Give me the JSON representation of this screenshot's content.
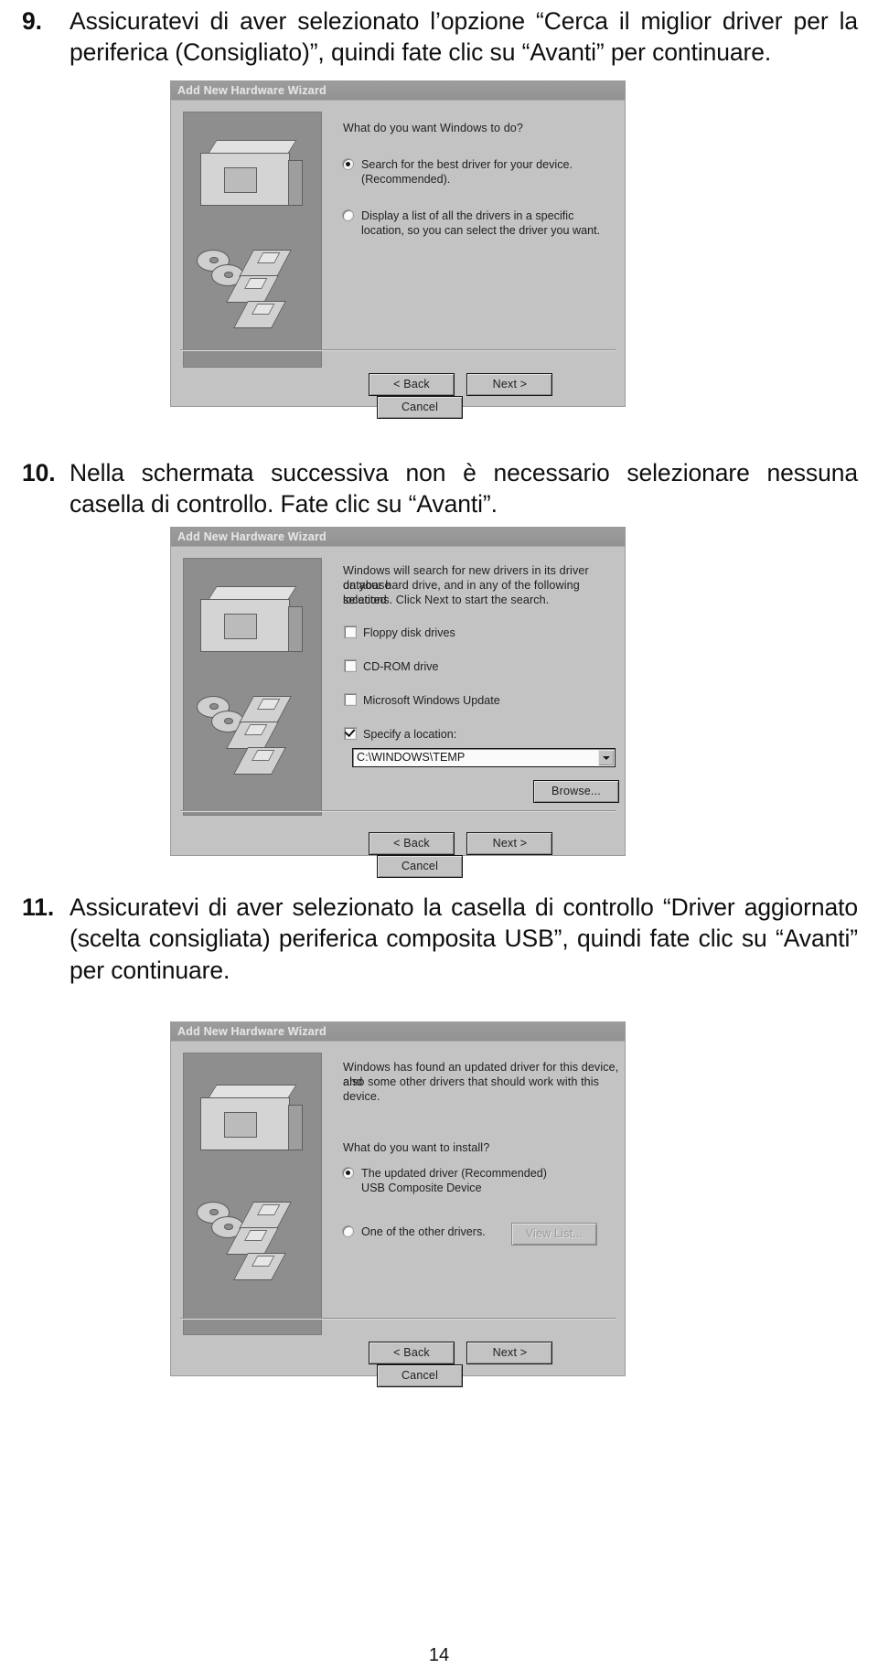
{
  "page": {
    "number": "14",
    "language": "it"
  },
  "instructions": [
    {
      "number": "9.",
      "text": "Assicuratevi di aver selezionato l’opzione “Cerca il miglior driver per la periferica (Consigliato)”, quindi fate clic su “Avanti” per continuare."
    },
    {
      "number": "10.",
      "text": "Nella schermata successiva non è necessario selezionare nessuna casella di controllo. Fate clic su “Avanti”."
    },
    {
      "number": "11.",
      "text": "Assicuratevi di aver selezionato la casella di controllo “Driver aggiornato (scelta consigliata) periferica composita USB”, quindi fate clic su “Avanti” per continuare."
    }
  ],
  "dialogs": [
    {
      "id": "wizard-step-1",
      "title": "Add New Hardware Wizard",
      "prompt": "What do you want Windows to do?",
      "options": [
        {
          "label_line1": "Search for the best driver for your device.",
          "label_line2": "(Recommended).",
          "selected": true
        },
        {
          "label_line1": "Display a list of all the drivers in a specific",
          "label_line2": "location, so you can select the driver you want.",
          "selected": false
        }
      ],
      "buttons": [
        {
          "label": "< Back",
          "disabled": false
        },
        {
          "label": "Next >",
          "disabled": false
        },
        {
          "label": "Cancel",
          "disabled": false
        }
      ]
    },
    {
      "id": "wizard-step-2",
      "title": "Add New Hardware Wizard",
      "body_line1": "Windows will search for new drivers in its driver database",
      "body_line2": "on your hard drive, and in any of the following selected",
      "body_line3": "locations. Click Next to start the search.",
      "checkboxes": [
        {
          "label": "Floppy disk drives",
          "checked": false
        },
        {
          "label": "CD-ROM drive",
          "checked": false
        },
        {
          "label": "Microsoft Windows Update",
          "checked": false
        },
        {
          "label": "Specify a location:",
          "checked": true
        }
      ],
      "location_value": "C:\\WINDOWS\\TEMP",
      "browse_button": "Browse...",
      "buttons": [
        {
          "label": "< Back",
          "disabled": false
        },
        {
          "label": "Next >",
          "disabled": false
        },
        {
          "label": "Cancel",
          "disabled": false
        }
      ]
    },
    {
      "id": "wizard-step-3",
      "title": "Add New Hardware Wizard",
      "body_line1": "Windows has found an updated driver for this device, and",
      "body_line2": "also some other drivers that should work with this device.",
      "prompt": "What do you want to install?",
      "options": [
        {
          "label_line1": "The updated driver (Recommended)",
          "label_line2": "USB Composite Device",
          "selected": true
        },
        {
          "label_line1": "One of the other drivers.",
          "label_line2": "",
          "selected": false
        }
      ],
      "view_list_button": "View List...",
      "buttons": [
        {
          "label": "< Back",
          "disabled": false
        },
        {
          "label": "Next >",
          "disabled": false
        },
        {
          "label": "Cancel",
          "disabled": false
        }
      ]
    }
  ]
}
